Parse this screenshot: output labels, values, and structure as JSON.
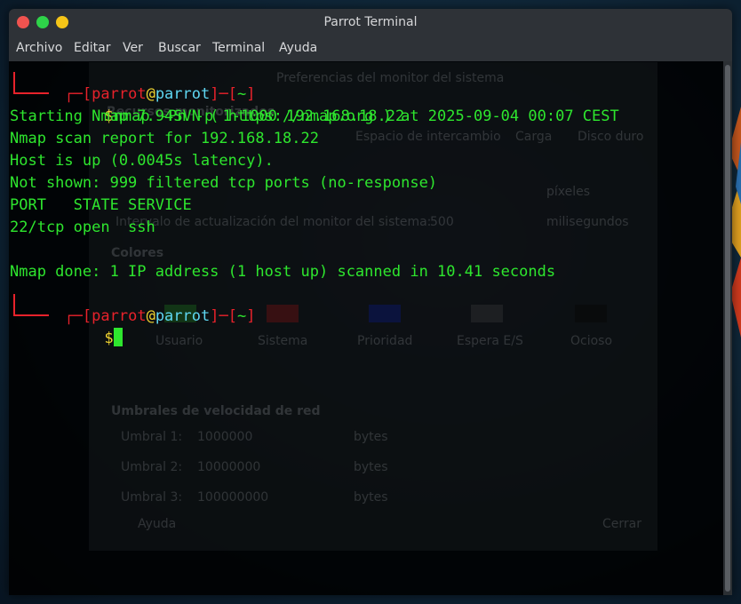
{
  "window": {
    "title": "Parrot Terminal"
  },
  "menu": [
    "Archivo",
    "Editar",
    "Ver",
    "Buscar",
    "Terminal",
    "Ayuda"
  ],
  "prompt": {
    "user": "parrot",
    "host": "parrot",
    "dir": "~",
    "symbol": "$"
  },
  "command": "nmap -Pn -p 1-1000 192.168.18.22",
  "output": [
    "Starting Nmap 7.94SVN ( https://nmap.org ) at 2025-09-04 00:07 CEST",
    "Nmap scan report for 192.168.18.22",
    "Host is up (0.0045s latency).",
    "Not shown: 999 filtered tcp ports (no-response)",
    "PORT   STATE SERVICE",
    "22/tcp open  ssh",
    "",
    "Nmap done: 1 IP address (1 host up) scanned in 10.41 seconds"
  ],
  "background_dialog": {
    "title": "Preferencias del monitor del sistema",
    "tab_labels": [
      "Espacio de intercambio",
      "Carga",
      "Disco duro"
    ],
    "section_resources": "Recursos monitorizados",
    "width_unit": "píxeles",
    "update_label": "Intervalo de actualización del monitor del sistema:",
    "update_value": "500",
    "update_unit": "milisegundos",
    "colors_title": "Colores",
    "color_labels": [
      "Usuario",
      "Sistema",
      "Prioridad",
      "Espera E/S",
      "Ocioso"
    ],
    "color_values": [
      "#1f7a1f",
      "#8a1010",
      "#0a1a8a",
      "#2a2a2a",
      "#050505"
    ],
    "net_title": "Umbrales de velocidad de red",
    "thresholds": [
      {
        "label": "Umbral 1:",
        "value": "1000000",
        "unit": "bytes"
      },
      {
        "label": "Umbral 2:",
        "value": "10000000",
        "unit": "bytes"
      },
      {
        "label": "Umbral 3:",
        "value": "100000000",
        "unit": "bytes"
      }
    ],
    "help_label": "Ayuda",
    "close_label": "Cerrar"
  },
  "colors": {
    "prompt_bracket": "#e8222b",
    "prompt_user": "#e8222b",
    "prompt_host": "#5fd7f2",
    "prompt_dollar": "#f2d531",
    "output": "#2ee62e"
  }
}
